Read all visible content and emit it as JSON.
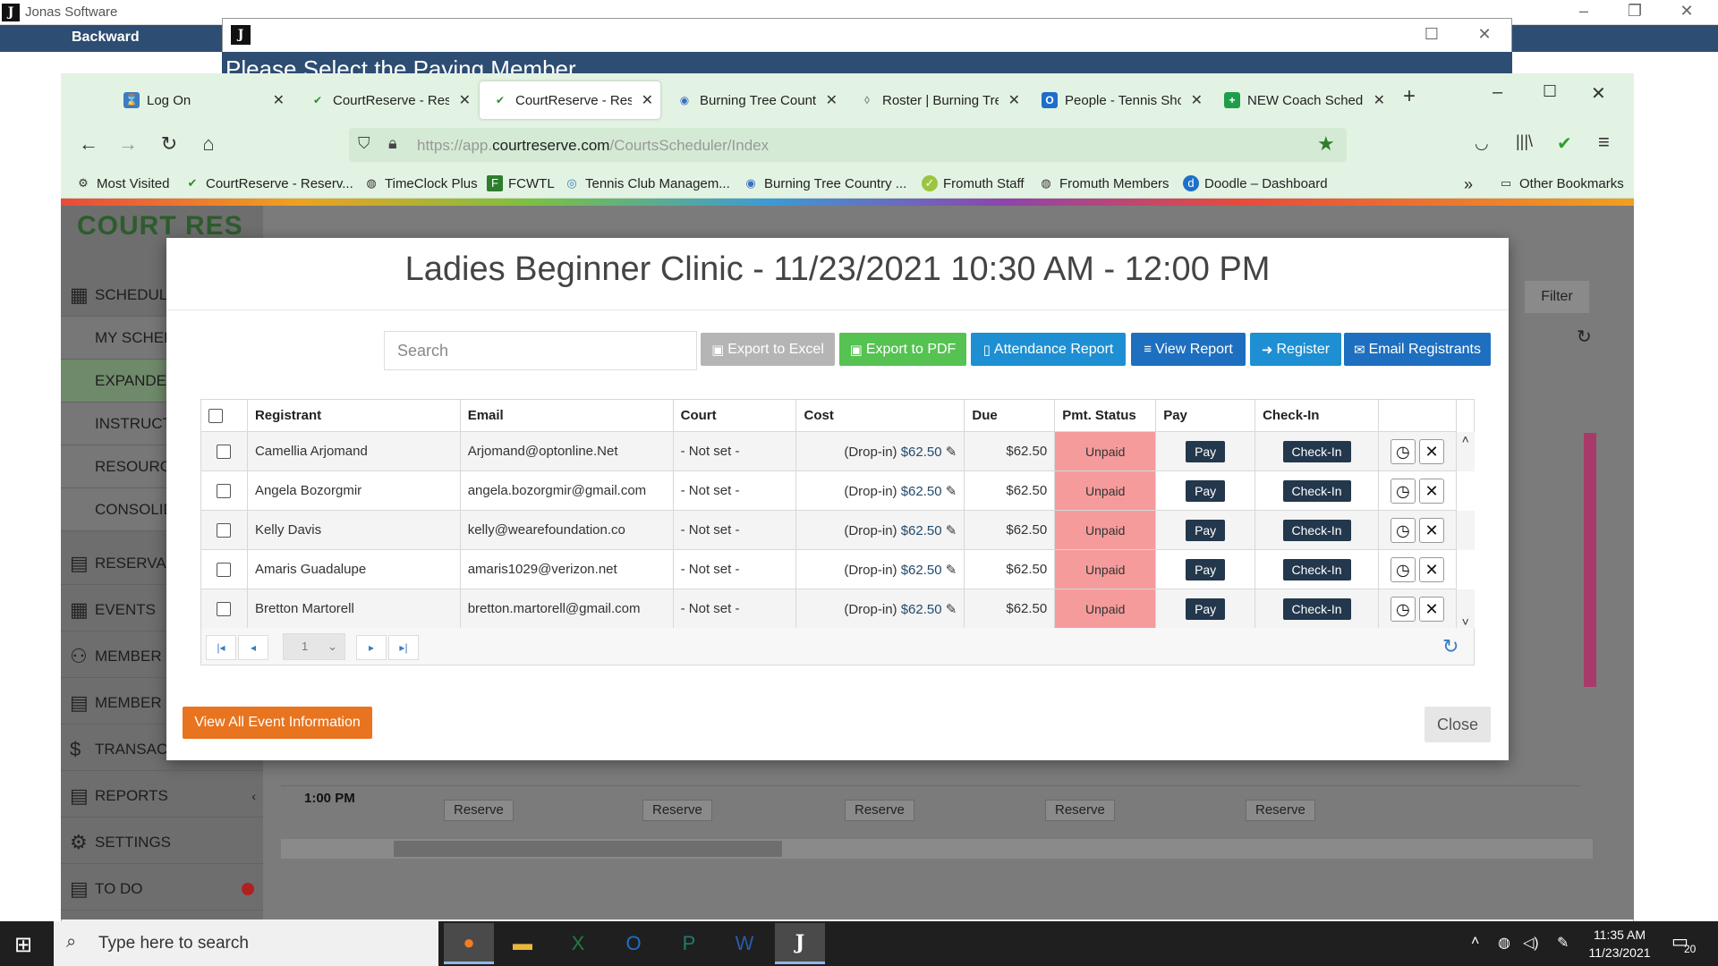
{
  "jonas": {
    "title": "Jonas Software",
    "menu_backward": "Backward",
    "dialog_title": "Please Select the Paying Member"
  },
  "browser": {
    "tabs": [
      {
        "label": "Log On",
        "icon_color": "#3b7dbf"
      },
      {
        "label": "CourtReserve - Rese",
        "icon_color": "#2e8b2e"
      },
      {
        "label": "CourtReserve - Rese",
        "icon_color": "#2e8b2e"
      },
      {
        "label": "Burning Tree Countr",
        "icon_color": "#3a6fc4"
      },
      {
        "label": "Roster | Burning Tre",
        "icon_color": "#888888"
      },
      {
        "label": "People - Tennis Shop",
        "icon_color": "#1e6fc9"
      },
      {
        "label": "NEW Coach Schedul",
        "icon_color": "#1e9e4a"
      }
    ],
    "url_prefix": "https://app.",
    "url_domain": "courtreserve.com",
    "url_path": "/CourtsScheduler/Index",
    "bookmarks": [
      "Most Visited",
      "CourtReserve - Reserv...",
      "TimeClock Plus",
      "FCWTL",
      "Tennis Club Managem...",
      "Burning Tree Country ...",
      "Fromuth Staff",
      "Fromuth Members",
      "Doodle – Dashboard"
    ],
    "other_bookmarks": "Other Bookmarks"
  },
  "sidebar": {
    "logo": "COURT RES",
    "items": [
      {
        "label": "SCHEDUL",
        "icon": "calendar-icon"
      },
      {
        "label": "MY SCHED"
      },
      {
        "label": "EXPANDED"
      },
      {
        "label": "INSTRUCT"
      },
      {
        "label": "RESOURCE"
      },
      {
        "label": "CONSOLID"
      },
      {
        "label": "RESERVA",
        "icon": "clipboard-icon"
      },
      {
        "label": "EVENTS",
        "icon": "calendar-icon"
      },
      {
        "label": "MEMBER",
        "icon": "members-icon"
      },
      {
        "label": "MEMBER",
        "icon": "clipboard-icon"
      },
      {
        "label": "TRANSAC",
        "icon": "transactions-icon"
      },
      {
        "label": "REPORTS",
        "icon": "reports-icon"
      },
      {
        "label": "SETTINGS",
        "icon": "gear-icon"
      },
      {
        "label": "TO DO",
        "icon": "todo-icon"
      }
    ]
  },
  "scheduler": {
    "filter": "Filter",
    "reserve_label": "Reserve",
    "time_label": "1:00 PM"
  },
  "modal": {
    "title": "Ladies Beginner Clinic - 11/23/2021 10:30 AM - 12:00 PM",
    "search_placeholder": "Search",
    "buttons": {
      "export_excel": "Export to Excel",
      "export_pdf": "Export to PDF",
      "attendance_report": "Attendance Report",
      "view_report": "View Report",
      "register": "Register",
      "email_registrants": "Email Registrants"
    },
    "columns": {
      "registrant": "Registrant",
      "email": "Email",
      "court": "Court",
      "cost": "Cost",
      "due": "Due",
      "pmt_status": "Pmt. Status",
      "pay": "Pay",
      "checkin": "Check-In"
    },
    "rows": [
      {
        "registrant": "Camellia Arjomand",
        "email": "Arjomand@optonline.Net",
        "court": "- Not set -",
        "cost_prefix": "(Drop-in)",
        "cost": "$62.50",
        "due": "$62.50",
        "status": "Unpaid",
        "pay": "Pay",
        "checkin": "Check-In"
      },
      {
        "registrant": "Angela Bozorgmir",
        "email": "angela.bozorgmir@gmail.com",
        "court": "- Not set -",
        "cost_prefix": "(Drop-in)",
        "cost": "$62.50",
        "due": "$62.50",
        "status": "Unpaid",
        "pay": "Pay",
        "checkin": "Check-In"
      },
      {
        "registrant": "Kelly Davis",
        "email": "kelly@wearefoundation.co",
        "court": "- Not set -",
        "cost_prefix": "(Drop-in)",
        "cost": "$62.50",
        "due": "$62.50",
        "status": "Unpaid",
        "pay": "Pay",
        "checkin": "Check-In"
      },
      {
        "registrant": "Amaris Guadalupe",
        "email": "amaris1029@verizon.net",
        "court": "- Not set -",
        "cost_prefix": "(Drop-in)",
        "cost": "$62.50",
        "due": "$62.50",
        "status": "Unpaid",
        "pay": "Pay",
        "checkin": "Check-In"
      },
      {
        "registrant": "Bretton Martorell",
        "email": "bretton.martorell@gmail.com",
        "court": "- Not set -",
        "cost_prefix": "(Drop-in)",
        "cost": "$62.50",
        "due": "$62.50",
        "status": "Unpaid",
        "pay": "Pay",
        "checkin": "Check-In"
      }
    ],
    "pager_page": "1",
    "view_all": "View All Event Information",
    "close": "Close"
  },
  "taskbar": {
    "search_placeholder": "Type here to search",
    "time": "11:35 AM",
    "date": "11/23/2021",
    "notifications": "20"
  }
}
